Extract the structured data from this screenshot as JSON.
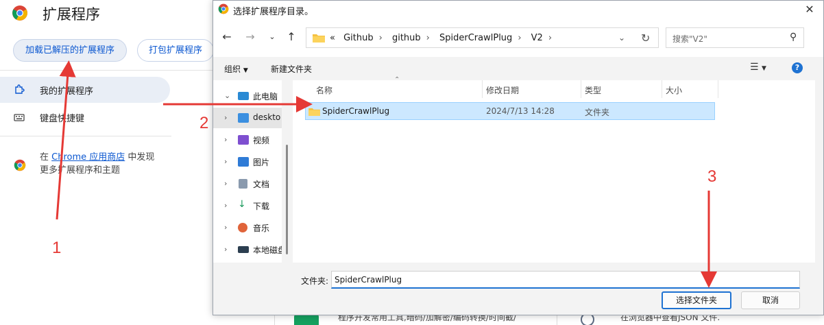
{
  "extensions_page": {
    "title": "扩展程序",
    "load_unpacked_label": "加载已解压的扩展程序",
    "pack_label": "打包扩展程序",
    "sidebar": {
      "my_extensions": "我的扩展程序",
      "shortcuts": "键盘快捷键"
    },
    "store_note": {
      "prefix": "在",
      "link": "Chrome 应用商店",
      "suffix": "中发现",
      "line2": "更多扩展程序和主题"
    },
    "bottom_card1": "程序开发常用工具,暗码/加解密/编码转换/时间截/",
    "bottom_card2": "在浏览器中查看JSON 文件."
  },
  "dialog": {
    "title": "选择扩展程序目录。",
    "breadcrumb": [
      "«",
      "Github",
      "github",
      "SpiderCrawlPlug",
      "V2"
    ],
    "search_placeholder": "搜索\"V2\"",
    "organize_label": "组织",
    "new_folder_label": "新建文件夹",
    "tree": [
      {
        "label": "此电脑",
        "icon": "pc-icon"
      },
      {
        "label": "deskto",
        "icon": "desktop-icon"
      },
      {
        "label": "视频",
        "icon": "video-icon"
      },
      {
        "label": "图片",
        "icon": "pictures-icon"
      },
      {
        "label": "文档",
        "icon": "documents-icon"
      },
      {
        "label": "下载",
        "icon": "downloads-icon"
      },
      {
        "label": "音乐",
        "icon": "music-icon"
      },
      {
        "label": "本地磁盘",
        "icon": "disk-icon"
      }
    ],
    "columns": {
      "name": "名称",
      "date": "修改日期",
      "type": "类型",
      "size": "大小"
    },
    "files": [
      {
        "name": "SpiderCrawlPlug",
        "date": "2024/7/13 14:28",
        "type": "文件夹"
      }
    ],
    "folder_label": "文件夹:",
    "folder_value": "SpiderCrawlPlug",
    "select_button": "选择文件夹",
    "cancel_button": "取消"
  },
  "annotations": [
    "1",
    "2",
    "3"
  ],
  "colors": {
    "accent": "#0b57d0",
    "arrow": "#e53935",
    "selection": "#cce8ff"
  }
}
